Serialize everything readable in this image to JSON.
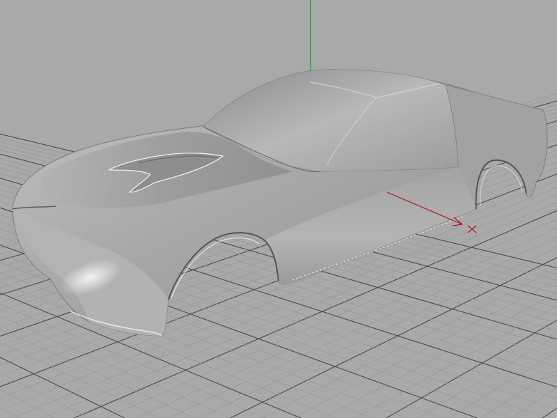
{
  "viewport": {
    "projection": "perspective",
    "background_color": "#a9a9a9",
    "grid": {
      "visible": true,
      "minor_color": "#9a9a9a",
      "major_color": "#4a4a4a"
    },
    "axes": {
      "y_axis_color": "#1f8f1f",
      "x_axis_color": "#b01818"
    },
    "model": {
      "object": "car body shell",
      "shading": "smooth",
      "material_color": "#a6a6a6",
      "highlight_color": "#f4f4f4",
      "shadow_color": "#6a6a6a"
    }
  }
}
